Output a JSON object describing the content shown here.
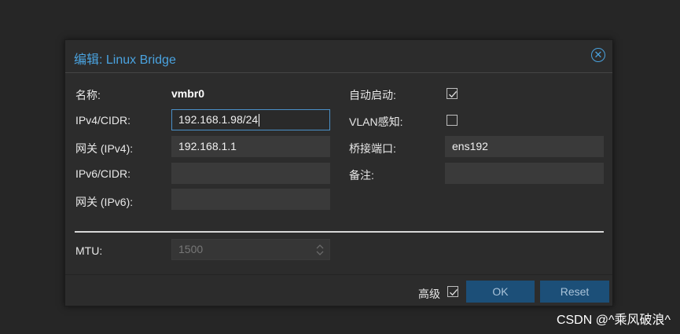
{
  "dialog": {
    "title": "编辑: Linux Bridge",
    "close_icon": "close-circle-icon"
  },
  "form": {
    "name_label": "名称:",
    "name_value": "vmbr0",
    "ipv4_label": "IPv4/CIDR:",
    "ipv4_value": "192.168.1.98/24",
    "gateway4_label": "网关 (IPv4):",
    "gateway4_value": "192.168.1.1",
    "ipv6_label": "IPv6/CIDR:",
    "ipv6_value": "",
    "gateway6_label": "网关 (IPv6):",
    "gateway6_value": "",
    "autostart_label": "自动启动:",
    "autostart_checked": true,
    "vlan_label": "VLAN感知:",
    "vlan_checked": false,
    "ports_label": "桥接端口:",
    "ports_value": "ens192",
    "comment_label": "备注:",
    "comment_value": "",
    "mtu_label": "MTU:",
    "mtu_placeholder": "1500"
  },
  "footer": {
    "advanced_label": "高级",
    "advanced_checked": true,
    "ok_label": "OK",
    "reset_label": "Reset"
  },
  "watermark": "CSDN @^乘风破浪^",
  "colors": {
    "accent": "#4aa3e0",
    "button_bg": "#1c4f78",
    "dialog_bg": "#2c2c2c",
    "field_bg": "#3a3a3a",
    "focus_border": "#4a90c8"
  }
}
